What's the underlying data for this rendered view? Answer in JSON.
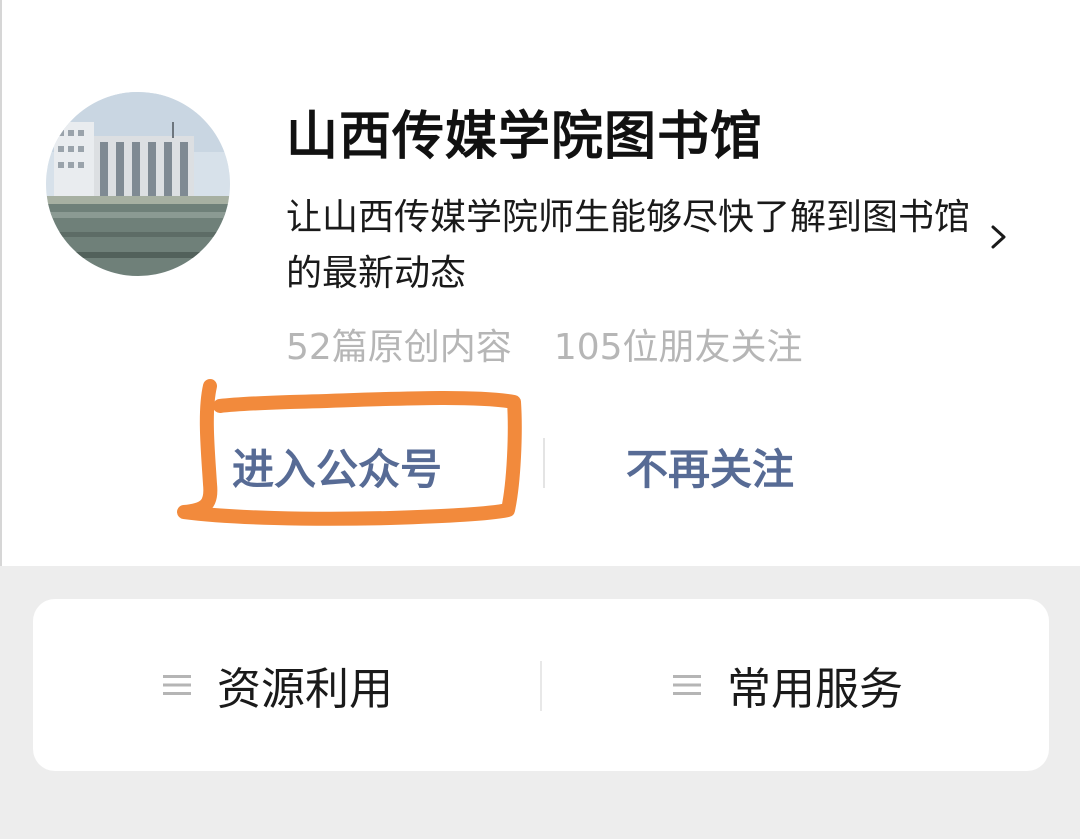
{
  "profile": {
    "name": "山西传媒学院图书馆",
    "description": "让山西传媒学院师生能够尽快了解到图书馆的最新动态",
    "stats": {
      "original_posts": "52篇原创内容",
      "friends_following": "105位朋友关注"
    },
    "avatar_icon": "library-building-photo",
    "chevron_icon": "chevron-right-icon"
  },
  "actions": {
    "enter_account": "进入公众号",
    "unfollow": "不再关注"
  },
  "menu": {
    "items": [
      {
        "label": "资源利用",
        "icon": "menu-lines-icon"
      },
      {
        "label": "常用服务",
        "icon": "menu-lines-icon"
      }
    ]
  },
  "colors": {
    "link": "#576b95",
    "stat_text": "#b6b6b6",
    "page_background": "#ededed",
    "highlight_annotation": "#f28a3c"
  }
}
